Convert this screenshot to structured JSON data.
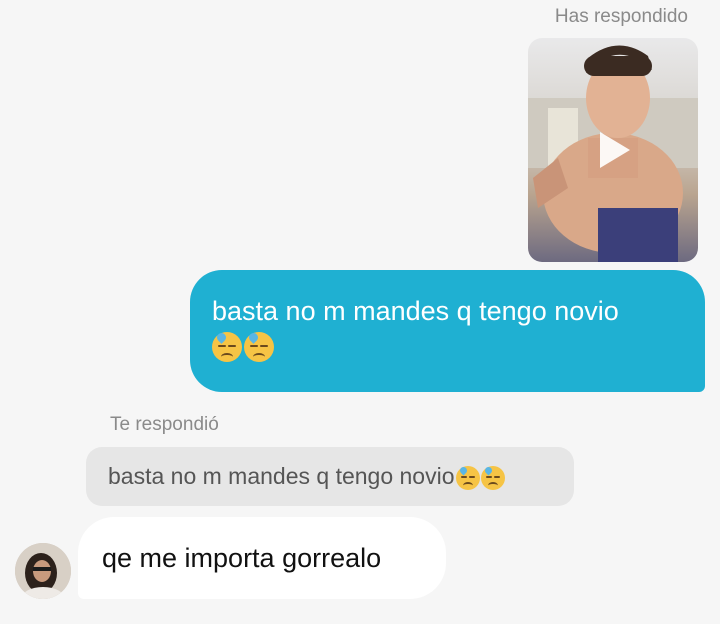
{
  "replied_label": "Has respondido",
  "outgoing": {
    "text": "basta no m mandes q tengo novio",
    "emojis": [
      "downcast-face-with-sweat",
      "downcast-face-with-sweat"
    ]
  },
  "they_replied_label": "Te respondió",
  "quoted": {
    "text": "basta no m mandes q tengo novio",
    "emojis": [
      "downcast-face-with-sweat",
      "downcast-face-with-sweat"
    ]
  },
  "incoming": {
    "text": "qe me importa gorrealo"
  },
  "colors": {
    "background": "#f6f6f6",
    "outgoing_bubble": "#1fb0d2",
    "incoming_bubble": "#ffffff",
    "quoted_bubble": "#e6e6e6",
    "label_text": "#8a8a8a"
  },
  "icons": {
    "story_play": "play-icon"
  }
}
